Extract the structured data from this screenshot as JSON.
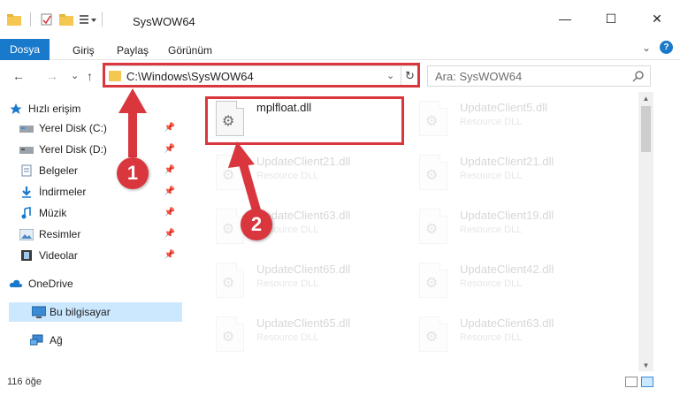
{
  "window": {
    "title": "SysWOW64",
    "minimize_glyph": "—",
    "maximize_glyph": "☐",
    "close_glyph": "✕"
  },
  "ribbon": {
    "tabs": [
      "Dosya",
      "Giriş",
      "Paylaş",
      "Görünüm"
    ],
    "expand_glyph": "⌄",
    "help_glyph": "?"
  },
  "navigation": {
    "back_glyph": "←",
    "forward_glyph": "→",
    "recent_glyph": "⌄",
    "up_glyph": "↑",
    "address": "C:\\Windows\\SysWOW64",
    "refresh_glyph": "↻",
    "search_placeholder": "Ara: SysWOW64"
  },
  "sidebar": {
    "items": [
      {
        "label": "Hızlı erişim",
        "icon": "star-icon",
        "pinned": false
      },
      {
        "label": "Yerel Disk (C:)",
        "icon": "drive-icon",
        "pinned": true
      },
      {
        "label": "Yerel Disk (D:)",
        "icon": "drive-icon",
        "pinned": true
      },
      {
        "label": "Belgeler",
        "icon": "documents-icon",
        "pinned": true
      },
      {
        "label": "İndirmeler",
        "icon": "download-icon",
        "pinned": true
      },
      {
        "label": "Müzik",
        "icon": "music-icon",
        "pinned": true
      },
      {
        "label": "Resimler",
        "icon": "pictures-icon",
        "pinned": true
      },
      {
        "label": "Videolar",
        "icon": "video-icon",
        "pinned": true
      },
      {
        "label": "OneDrive",
        "icon": "cloud-icon",
        "pinned": false
      },
      {
        "label": "Bu bilgisayar",
        "icon": "computer-icon",
        "pinned": false,
        "selected": true
      },
      {
        "label": "Ağ",
        "icon": "network-icon",
        "pinned": false
      }
    ],
    "pin_glyph": "📌"
  },
  "files": [
    {
      "name": "mplfloat.dll",
      "type": ""
    },
    {
      "name": "UpdateClient5.dll",
      "type": "Resource DLL"
    },
    {
      "name": "UpdateClient21.dll",
      "type": "Resource DLL"
    },
    {
      "name": "UpdateClient21.dll",
      "type": "Resource DLL"
    },
    {
      "name": "UpdateClient63.dll",
      "type": "Resource DLL"
    },
    {
      "name": "UpdateClient19.dll",
      "type": "Resource DLL"
    },
    {
      "name": "UpdateClient65.dll",
      "type": "Resource DLL"
    },
    {
      "name": "UpdateClient42.dll",
      "type": "Resource DLL"
    },
    {
      "name": "UpdateClient65.dll",
      "type": "Resource DLL"
    },
    {
      "name": "UpdateClient63.dll",
      "type": "Resource DLL"
    }
  ],
  "status": {
    "item_count": "116 öğe"
  },
  "annotations": {
    "step1": "1",
    "step2": "2",
    "highlight_color": "#d9363e"
  },
  "colors": {
    "accent": "#1979ca",
    "selection": "#cce8ff"
  }
}
